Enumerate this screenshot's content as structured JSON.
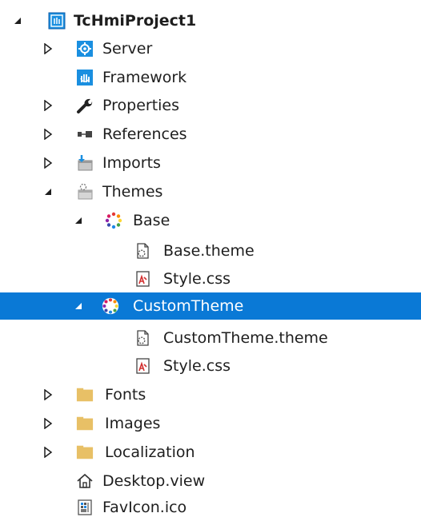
{
  "colors": {
    "selection": "#0a79d6",
    "text": "#1e1e1e",
    "selected_text": "#ffffff",
    "folder": "#e8c066",
    "blue_icon": "#1a8fe0"
  },
  "tree": [
    {
      "label": "TcHmiProject1",
      "arrow": "expanded",
      "icon": "project-icon",
      "bold": true
    },
    {
      "label": "Server",
      "arrow": "collapsed",
      "icon": "server-icon"
    },
    {
      "label": "Framework",
      "arrow": "none",
      "icon": "framework-icon"
    },
    {
      "label": "Properties",
      "arrow": "collapsed",
      "icon": "wrench-icon"
    },
    {
      "label": "References",
      "arrow": "collapsed",
      "icon": "references-icon"
    },
    {
      "label": "Imports",
      "arrow": "collapsed",
      "icon": "imports-icon"
    },
    {
      "label": "Themes",
      "arrow": "expanded",
      "icon": "themes-icon"
    },
    {
      "label": "Base",
      "arrow": "expanded",
      "icon": "theme-palette-icon"
    },
    {
      "label": "Base.theme",
      "arrow": "none",
      "icon": "theme-file-icon"
    },
    {
      "label": "Style.css",
      "arrow": "none",
      "icon": "css-file-icon"
    },
    {
      "label": "CustomTheme",
      "arrow": "expanded",
      "icon": "theme-palette-icon",
      "selected": true
    },
    {
      "label": "CustomTheme.theme",
      "arrow": "none",
      "icon": "theme-file-icon"
    },
    {
      "label": "Style.css",
      "arrow": "none",
      "icon": "css-file-icon"
    },
    {
      "label": "Fonts",
      "arrow": "collapsed",
      "icon": "folder-icon"
    },
    {
      "label": "Images",
      "arrow": "collapsed",
      "icon": "folder-icon"
    },
    {
      "label": "Localization",
      "arrow": "collapsed",
      "icon": "folder-icon"
    },
    {
      "label": "Desktop.view",
      "arrow": "none",
      "icon": "home-icon"
    },
    {
      "label": "FavIcon.ico",
      "arrow": "none",
      "icon": "image-file-icon"
    }
  ]
}
